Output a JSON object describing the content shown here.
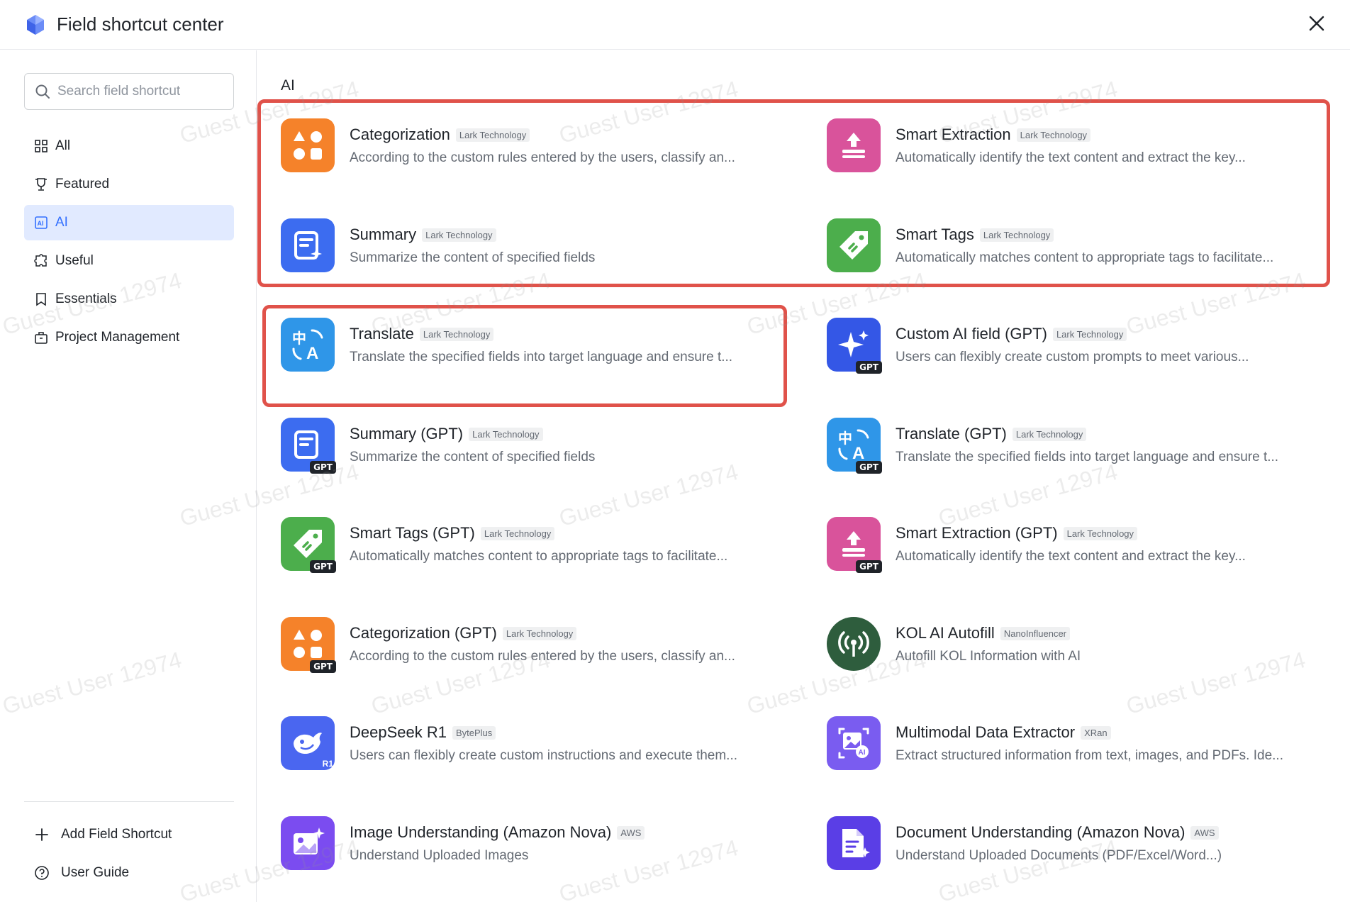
{
  "header": {
    "title": "Field shortcut center"
  },
  "sidebar": {
    "search_placeholder": "Search field shortcut",
    "items": [
      {
        "label": "All",
        "icon": "grid-icon"
      },
      {
        "label": "Featured",
        "icon": "trophy-icon"
      },
      {
        "label": "AI",
        "icon": "ai-icon",
        "active": true
      },
      {
        "label": "Useful",
        "icon": "puzzle-icon"
      },
      {
        "label": "Essentials",
        "icon": "bookmark-icon"
      },
      {
        "label": "Project Management",
        "icon": "briefcase-icon"
      }
    ],
    "add_label": "Add Field Shortcut",
    "guide_label": "User Guide"
  },
  "main": {
    "section_title": "AI",
    "cards": [
      {
        "name": "Categorization",
        "tag": "Lark Technology",
        "desc": "According to the custom rules entered by the users, classify an...",
        "color": "#f5822a",
        "icon": "categorize-icon"
      },
      {
        "name": "Smart Extraction",
        "tag": "Lark Technology",
        "desc": "Automatically identify the text content and extract the key...",
        "color": "#d9539b",
        "icon": "extract-icon"
      },
      {
        "name": "Summary",
        "tag": "Lark Technology",
        "desc": "Summarize the content of specified fields",
        "color": "#3c6cf0",
        "icon": "summary-icon"
      },
      {
        "name": "Smart Tags",
        "tag": "Lark Technology",
        "desc": "Automatically matches content to appropriate tags to facilitate...",
        "color": "#4cae4c",
        "icon": "tag-icon"
      },
      {
        "name": "Translate",
        "tag": "Lark Technology",
        "desc": "Translate the specified fields into target language and ensure t...",
        "color": "#2f96e8",
        "icon": "translate-icon"
      },
      {
        "name": "Custom AI field (GPT)",
        "tag": "Lark Technology",
        "desc": "Users can flexibly create custom prompts to meet various...",
        "color": "#3457e6",
        "icon": "sparkle-icon",
        "gpt": true
      },
      {
        "name": "Summary (GPT)",
        "tag": "Lark Technology",
        "desc": "Summarize the content of specified fields",
        "color": "#3c6cf0",
        "icon": "summary-icon",
        "gpt": true
      },
      {
        "name": "Translate (GPT)",
        "tag": "Lark Technology",
        "desc": "Translate the specified fields into target language and ensure t...",
        "color": "#2f96e8",
        "icon": "translate-icon",
        "gpt": true
      },
      {
        "name": "Smart Tags (GPT)",
        "tag": "Lark Technology",
        "desc": "Automatically matches content to appropriate tags to facilitate...",
        "color": "#4cae4c",
        "icon": "tag-icon",
        "gpt": true
      },
      {
        "name": "Smart Extraction (GPT)",
        "tag": "Lark Technology",
        "desc": "Automatically identify the text content and extract the key...",
        "color": "#d9539b",
        "icon": "extract-icon",
        "gpt": true
      },
      {
        "name": "Categorization (GPT)",
        "tag": "Lark Technology",
        "desc": "According to the custom rules entered by the users, classify an...",
        "color": "#f5822a",
        "icon": "categorize-icon",
        "gpt": true
      },
      {
        "name": "KOL AI Autofill",
        "tag": "NanoInfluencer",
        "desc": "Autofill KOL Information with AI",
        "color": "#2e5d3d",
        "icon": "broadcast-icon"
      },
      {
        "name": "DeepSeek R1",
        "tag": "BytePlus",
        "desc": "Users can flexibly create custom instructions and execute them...",
        "color": "#4a66f0",
        "icon": "whale-icon",
        "badge": "R1"
      },
      {
        "name": "Multimodal Data Extractor",
        "tag": "XRan",
        "desc": "Extract structured information from text, images, and PDFs. Ide...",
        "color": "#7a5cf0",
        "icon": "image-ai-icon"
      },
      {
        "name": "Image Understanding (Amazon Nova)",
        "tag": "AWS",
        "desc": "Understand Uploaded Images",
        "color": "#7b4cf0",
        "icon": "image-sparkle-icon"
      },
      {
        "name": "Document Understanding (Amazon Nova)",
        "tag": "AWS",
        "desc": "Understand Uploaded Documents (PDF/Excel/Word...)",
        "color": "#5a3ee6",
        "icon": "document-icon"
      }
    ]
  },
  "watermark": "Guest User 12974"
}
